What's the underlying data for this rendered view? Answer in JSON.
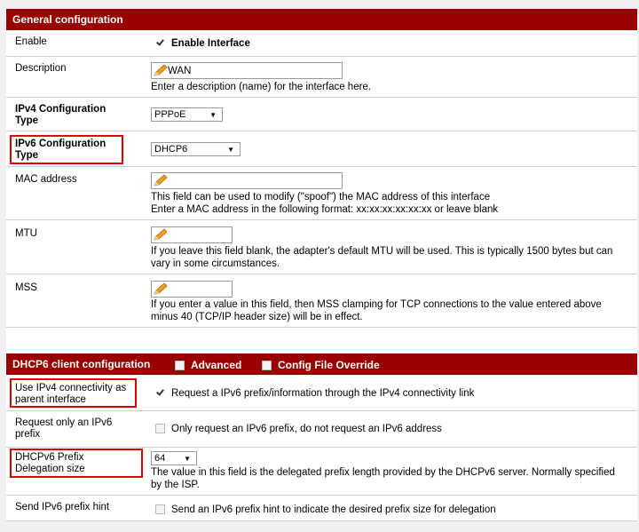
{
  "general": {
    "header": "General configuration",
    "enable": {
      "label": "Enable",
      "checkbox_label": "Enable Interface",
      "checked": true
    },
    "description": {
      "label": "Description",
      "value": "WAN",
      "help": "Enter a description (name) for the interface here."
    },
    "ipv4_type": {
      "label_line1": "IPv4 Configuration",
      "label_line2": "Type",
      "selected": "PPPoE"
    },
    "ipv6_type": {
      "label_line1": "IPv6 Configuration",
      "label_line2": "Type",
      "selected": "DHCP6"
    },
    "mac": {
      "label": "MAC address",
      "value": "",
      "help_line1": "This field can be used to modify (\"spoof\") the MAC address of this interface",
      "help_line2": "Enter a MAC address in the following format: xx:xx:xx:xx:xx:xx or leave blank"
    },
    "mtu": {
      "label": "MTU",
      "value": "",
      "help_line1": "If you leave this field blank, the adapter's default MTU will be used. This is typically 1500 bytes but can",
      "help_line2": "vary in some circumstances."
    },
    "mss": {
      "label": "MSS",
      "value": "",
      "help_line1": "If you enter a value in this field, then MSS clamping for TCP connections to the value entered above",
      "help_line2": "minus 40 (TCP/IP header size) will be in effect."
    }
  },
  "dhcp6": {
    "header": "DHCP6 client configuration",
    "advanced_label": "Advanced",
    "advanced_checked": false,
    "override_label": "Config File Override",
    "override_checked": false,
    "use_ipv4": {
      "label_line1": "Use IPv4 connectivity as",
      "label_line2": "parent interface",
      "checkbox_label": "Request a IPv6 prefix/information through the IPv4 connectivity link",
      "checked": true
    },
    "prefix_only": {
      "label_line1": "Request only an IPv6",
      "label_line2": "prefix",
      "checkbox_label": "Only request an IPv6 prefix, do not request an IPv6 address",
      "checked": false
    },
    "delegation": {
      "label_line1": "DHCPv6 Prefix",
      "label_line2": "Delegation size",
      "selected": "64",
      "help_line1": "The value in this field is the delegated prefix length provided by the DHCPv6 server. Normally specified",
      "help_line2": "by the ISP."
    },
    "hint": {
      "label": "Send IPv6 prefix hint",
      "checkbox_label": "Send an IPv6 prefix hint to indicate the desired prefix size for delegation",
      "checked": false
    }
  },
  "icons": {
    "pencil": "pencil-icon",
    "dropdown": "chevron-down-icon",
    "check": "checkmark"
  },
  "colors": {
    "header_bg": "#990000",
    "highlight": "#e00000"
  }
}
